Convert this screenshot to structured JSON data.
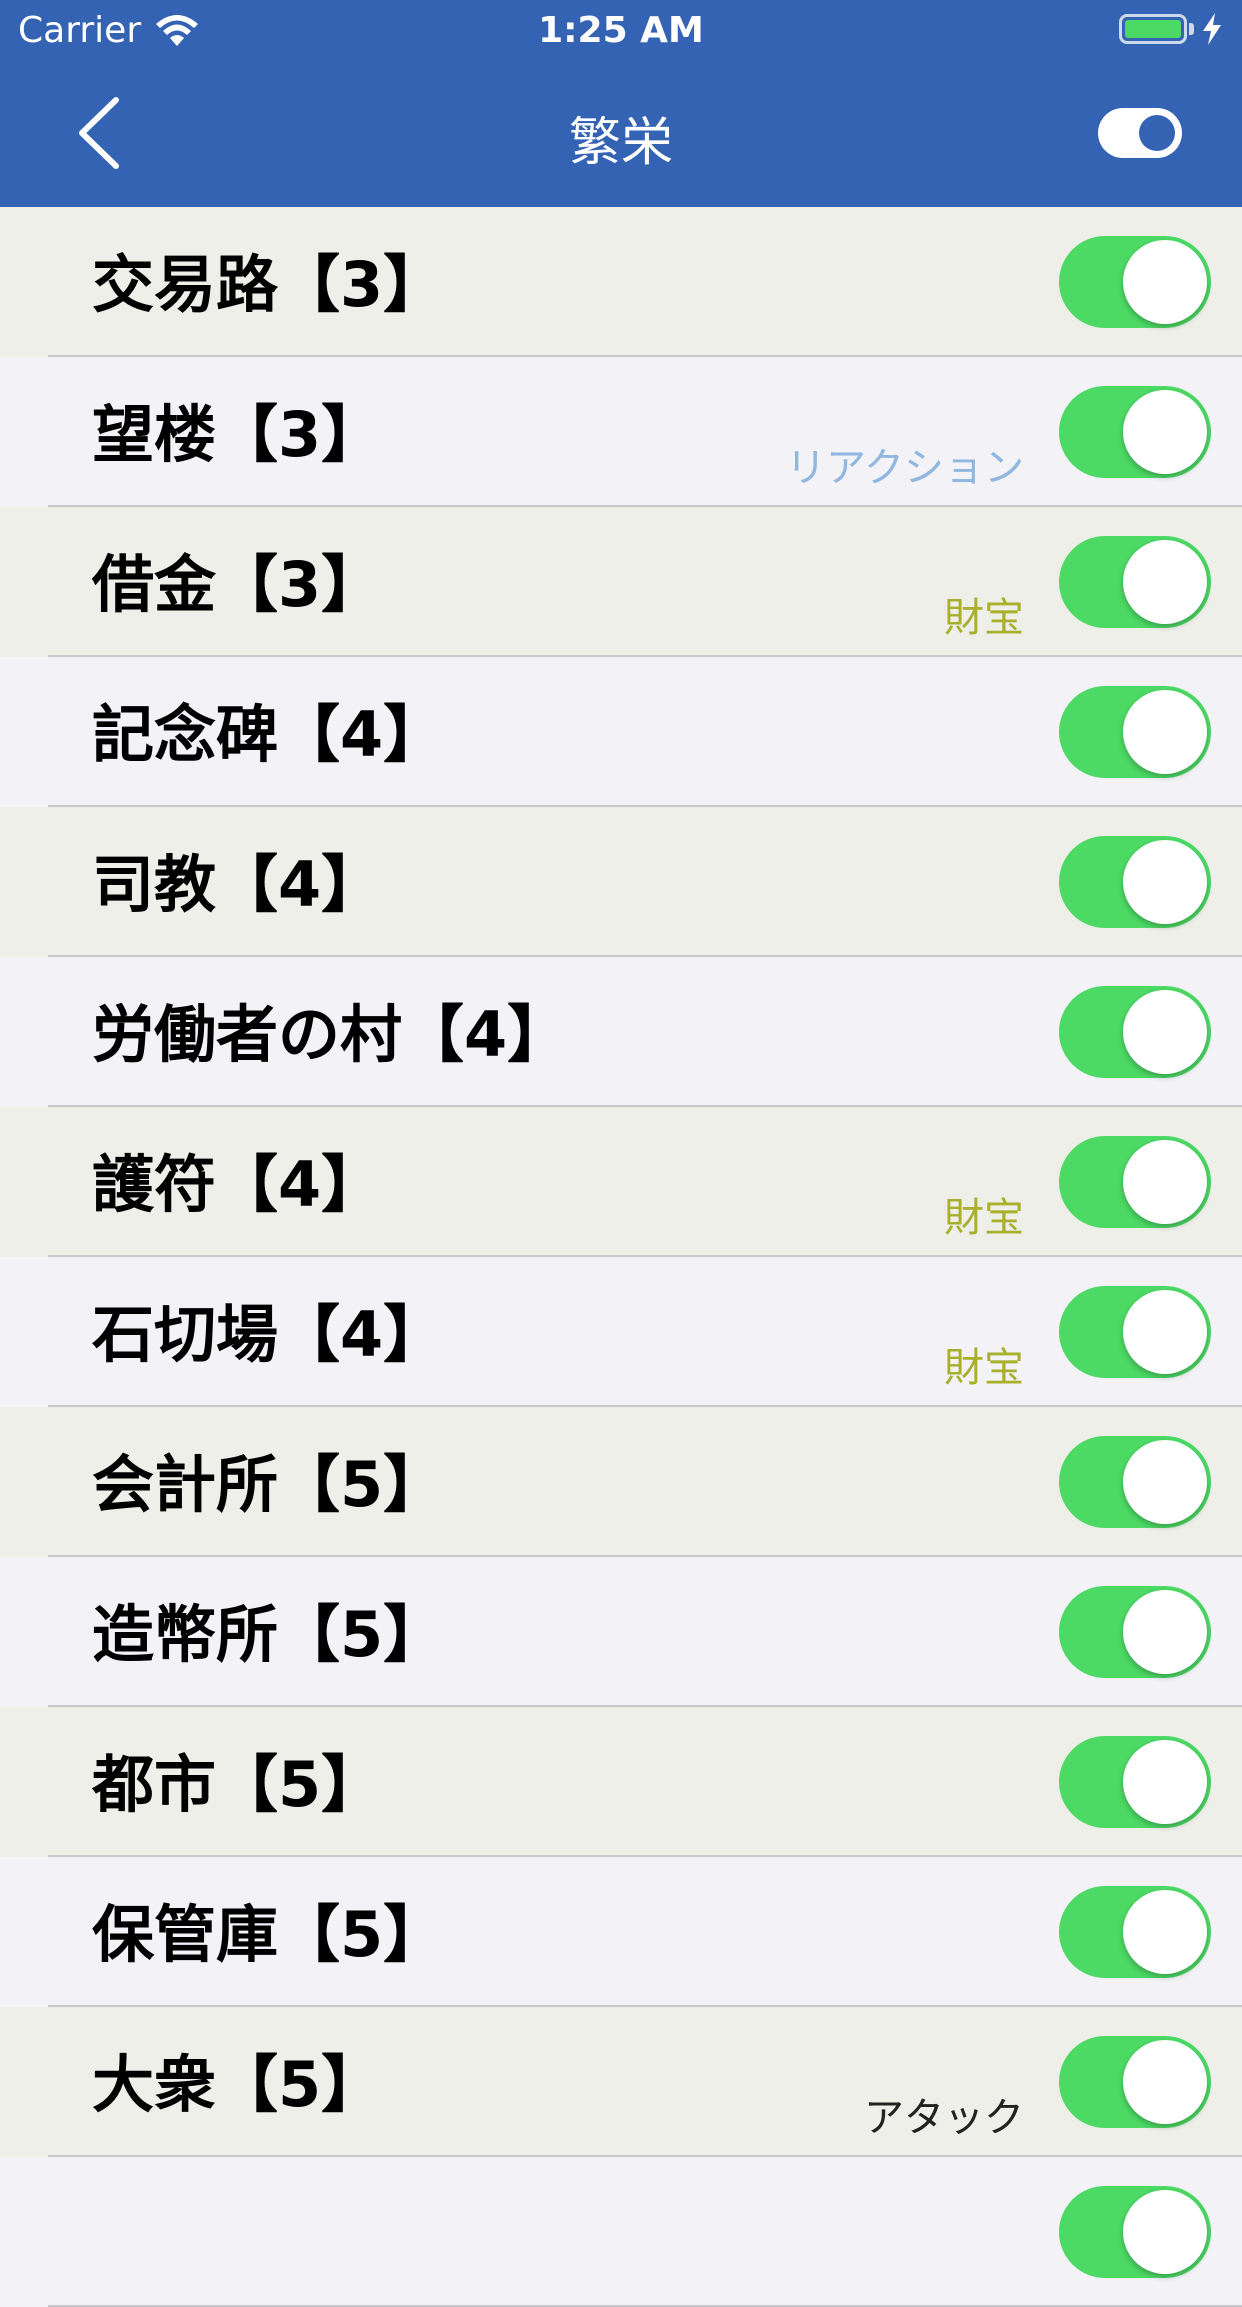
{
  "status_bar": {
    "carrier": "Carrier",
    "time": "1:25 AM"
  },
  "nav": {
    "title": "繁栄",
    "back_icon": "chevron-left-icon",
    "toggle_on": true
  },
  "colors": {
    "nav_bg": "#3563b4",
    "toggle_on": "#4cd964",
    "tag_reaction": "#8fb7e0",
    "tag_treasure": "#a8b02a",
    "tag_attack": "#222222"
  },
  "rows": [
    {
      "label": "交易路【3】",
      "tag": "",
      "tag_color": "",
      "on": true
    },
    {
      "label": "望楼【3】",
      "tag": "リアクション",
      "tag_color": "#8fb7e0",
      "on": true
    },
    {
      "label": "借金【3】",
      "tag": "財宝",
      "tag_color": "#a8b02a",
      "on": true
    },
    {
      "label": "記念碑【4】",
      "tag": "",
      "tag_color": "",
      "on": true
    },
    {
      "label": "司教【4】",
      "tag": "",
      "tag_color": "",
      "on": true
    },
    {
      "label": "労働者の村【4】",
      "tag": "",
      "tag_color": "",
      "on": true
    },
    {
      "label": "護符【4】",
      "tag": "財宝",
      "tag_color": "#a8b02a",
      "on": true
    },
    {
      "label": "石切場【4】",
      "tag": "財宝",
      "tag_color": "#a8b02a",
      "on": true
    },
    {
      "label": "会計所【5】",
      "tag": "",
      "tag_color": "",
      "on": true
    },
    {
      "label": "造幣所【5】",
      "tag": "",
      "tag_color": "",
      "on": true
    },
    {
      "label": "都市【5】",
      "tag": "",
      "tag_color": "",
      "on": true
    },
    {
      "label": "保管庫【5】",
      "tag": "",
      "tag_color": "",
      "on": true
    },
    {
      "label": "大衆【5】",
      "tag": "アタック",
      "tag_color": "#222222",
      "on": true
    },
    {
      "label": "",
      "tag": "",
      "tag_color": "",
      "on": true
    }
  ]
}
